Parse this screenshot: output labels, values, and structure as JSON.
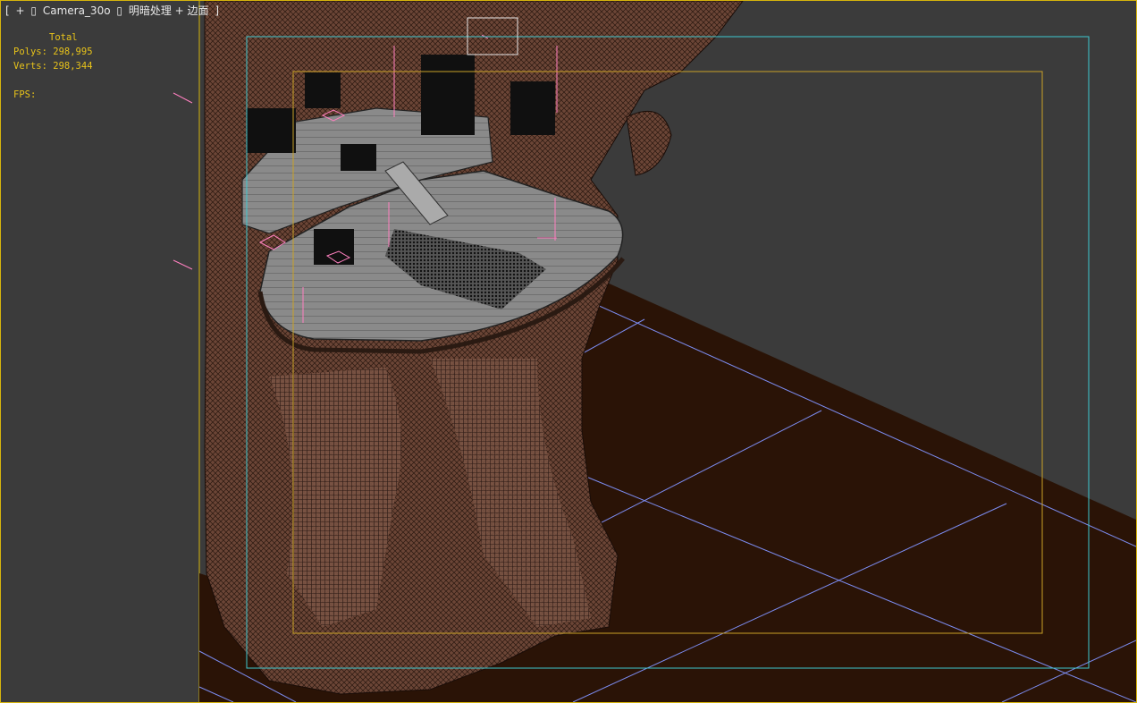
{
  "viewport": {
    "label": {
      "open_bracket": "[",
      "plus": "+",
      "sep1": "▯",
      "camera": "Camera_30o",
      "sep2": "▯",
      "shading": "明暗处理 + 边面",
      "close_bracket": "]"
    },
    "stats": {
      "title": "Total",
      "polys_label": "Polys:",
      "polys_value": "298,995",
      "verts_label": "Verts:",
      "verts_value": "298,344",
      "fps_label": "FPS:"
    }
  },
  "colors": {
    "viewport_border": "#d6b40c",
    "background": "#3b3b3b",
    "stats_text": "#e8c31a",
    "safe_frame_outer": "#3ec8d0",
    "safe_frame_inner": "#c9a227",
    "ground": "#2a1306",
    "grid": "#7c8cf0",
    "model_wire": "#6e4a3a"
  }
}
